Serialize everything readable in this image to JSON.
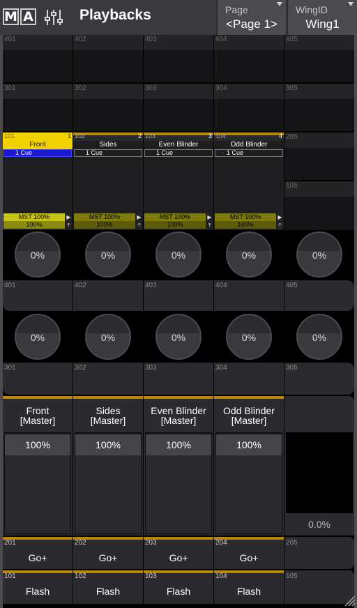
{
  "header": {
    "logo": [
      "M",
      "A"
    ],
    "title": "Playbacks",
    "page": {
      "label": "Page",
      "value": "<Page 1>"
    },
    "wing": {
      "label": "WingID",
      "value": "Wing1"
    }
  },
  "exec_rows": {
    "top": [
      "401",
      "402",
      "403",
      "404",
      "405"
    ],
    "second": [
      "301",
      "302",
      "303",
      "304",
      "305"
    ]
  },
  "playbacks": [
    {
      "num": "101",
      "page_num": "1",
      "name": "Front",
      "cue": "1  Cue",
      "mst": "MST 100%",
      "level": "100%"
    },
    {
      "num": "102",
      "page_num": "2",
      "name": "Sides",
      "cue": "1  Cue",
      "mst": "MST 100%",
      "level": "100%"
    },
    {
      "num": "103",
      "page_num": "3",
      "name": "Even Blinder",
      "cue": "1  Cue",
      "mst": "MST 100%",
      "level": "100%"
    },
    {
      "num": "104",
      "page_num": "4",
      "name": "Odd Blinder",
      "cue": "1  Cue",
      "mst": "MST 100%",
      "level": "100%"
    }
  ],
  "playback_empty": {
    "top": "205",
    "bottom": "105"
  },
  "knob_rows": [
    {
      "values": [
        "0%",
        "0%",
        "0%",
        "0%",
        "0%"
      ],
      "labels": [
        "401",
        "402",
        "403",
        "404",
        "405"
      ]
    },
    {
      "values": [
        "0%",
        "0%",
        "0%",
        "0%",
        "0%"
      ],
      "labels": [
        "301",
        "302",
        "303",
        "304",
        "305"
      ]
    }
  ],
  "faders": [
    {
      "line1": "Front",
      "line2": "[Master]",
      "value": "100%"
    },
    {
      "line1": "Sides",
      "line2": "[Master]",
      "value": "100%"
    },
    {
      "line1": "Even Blinder",
      "line2": "[Master]",
      "value": "100%"
    },
    {
      "line1": "Odd Blinder",
      "line2": "[Master]",
      "value": "100%"
    },
    {
      "line1": "",
      "line2": "",
      "value": "0.0%"
    }
  ],
  "go_buttons": [
    {
      "num": "201",
      "label": "Go+"
    },
    {
      "num": "202",
      "label": "Go+"
    },
    {
      "num": "203",
      "label": "Go+"
    },
    {
      "num": "204",
      "label": "Go+"
    },
    {
      "num": "205",
      "label": ""
    }
  ],
  "flash_buttons": [
    {
      "num": "101",
      "label": "Flash"
    },
    {
      "num": "102",
      "label": "Flash"
    },
    {
      "num": "103",
      "label": "Flash"
    },
    {
      "num": "104",
      "label": "Flash"
    },
    {
      "num": "105",
      "label": ""
    }
  ],
  "colors": {
    "accent": "#f1d200",
    "exec_bar": "#b8860b",
    "active_cue": "#1a1acc"
  },
  "icons": [
    "sliders-icon",
    "chevron-down-icon",
    "up-arrow-icon",
    "resize-grip-icon"
  ]
}
